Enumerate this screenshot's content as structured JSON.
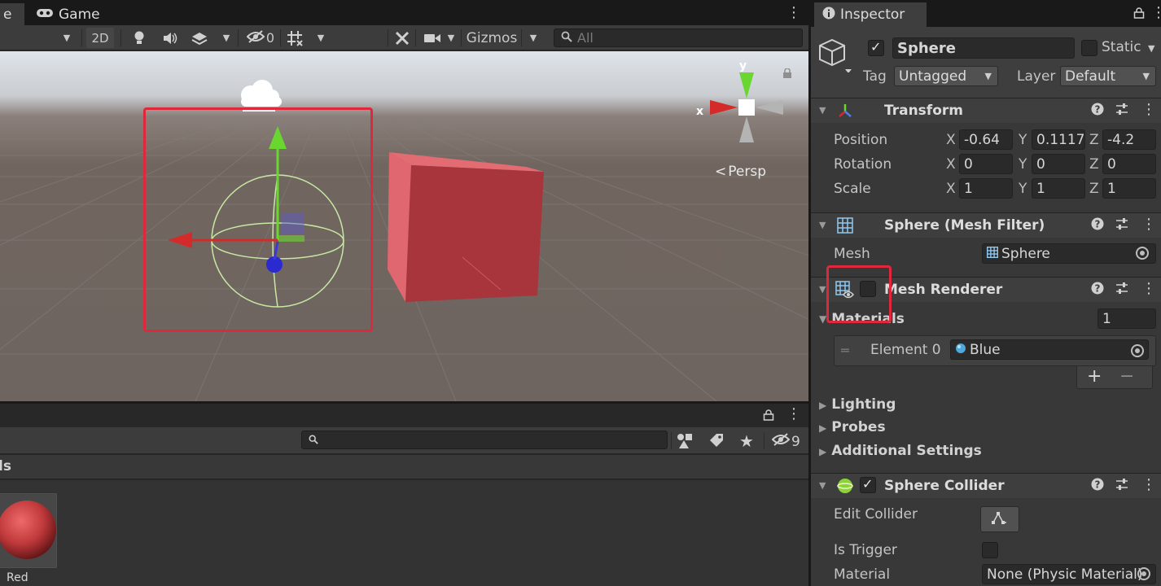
{
  "scene": {
    "tabs": [
      {
        "label": "e"
      },
      {
        "label": "Game"
      }
    ],
    "toolbar": {
      "mode_2d": "2D",
      "hidden_count": "0",
      "gizmos_label": "Gizmos",
      "search_placeholder": "All"
    },
    "viewport": {
      "orientation_label": "Persp",
      "gizmo_axes": {
        "x": "x",
        "y": "y"
      }
    }
  },
  "project": {
    "search_placeholder": "",
    "hidden_count": "9",
    "breadcrumb": "ls",
    "assets": [
      {
        "name": "Red",
        "color": "#c0393b"
      }
    ]
  },
  "inspector": {
    "tab_label": "Inspector",
    "object": {
      "name": "Sphere",
      "active": true,
      "static_label": "Static",
      "tag_label": "Tag",
      "tag_value": "Untagged",
      "layer_label": "Layer",
      "layer_value": "Default"
    },
    "transform": {
      "title": "Transform",
      "rows": [
        {
          "label": "Position",
          "x": "-0.64",
          "y": "0.1117",
          "z": "-4.2"
        },
        {
          "label": "Rotation",
          "x": "0",
          "y": "0",
          "z": "0"
        },
        {
          "label": "Scale",
          "x": "1",
          "y": "1",
          "z": "1"
        }
      ],
      "axes": {
        "x": "X",
        "y": "Y",
        "z": "Z"
      }
    },
    "mesh_filter": {
      "title": "Sphere (Mesh Filter)",
      "mesh_label": "Mesh",
      "mesh_value": "Sphere"
    },
    "mesh_renderer": {
      "title": "Mesh Renderer",
      "enabled": false,
      "materials_label": "Materials",
      "materials_count": "1",
      "element_label": "Element 0",
      "element_value": "Blue",
      "add_symbol": "+",
      "remove_symbol": "−",
      "foldouts": [
        "Lighting",
        "Probes",
        "Additional Settings"
      ]
    },
    "sphere_collider": {
      "title": "Sphere Collider",
      "enabled": true,
      "edit_collider_label": "Edit Collider",
      "is_trigger_label": "Is Trigger",
      "is_trigger": false,
      "material_label": "Material",
      "material_value": "None (Physic Material)"
    }
  },
  "colors": {
    "highlight": "#e0283c",
    "x_axis": "#d42a2a",
    "y_axis": "#6ad630",
    "z_axis": "#3a3ad8",
    "cube": "#b23a42",
    "material_blue": "#4ea8de"
  }
}
